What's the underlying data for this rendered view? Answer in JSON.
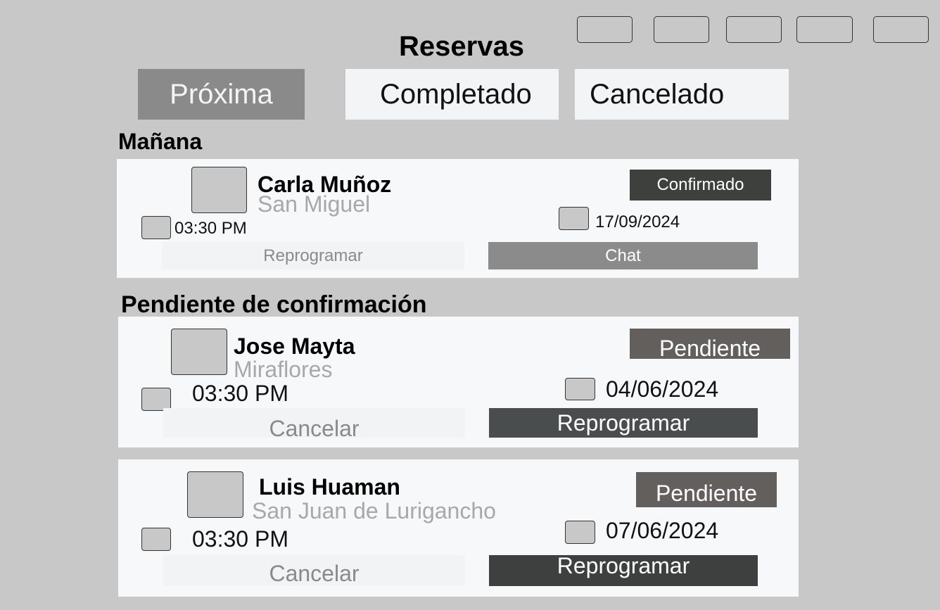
{
  "header": {
    "title": "Reservas"
  },
  "tabs": [
    {
      "label": "Próxima"
    },
    {
      "label": "Completado"
    },
    {
      "label": "Cancelado"
    }
  ],
  "sections": [
    {
      "heading": "Mañana",
      "cards": [
        {
          "name": "Carla Muñoz",
          "location": "San Miguel",
          "time": "03:30 PM",
          "date": "17/09/2024",
          "status": "Confirmado",
          "secondary_action": "Reprogramar",
          "primary_action": "Chat"
        }
      ]
    },
    {
      "heading": "Pendiente de confirmación",
      "cards": [
        {
          "name": "Jose Mayta",
          "location": "Miraflores",
          "time": "03:30 PM",
          "date": "04/06/2024",
          "status": "Pendiente",
          "secondary_action": "Cancelar",
          "primary_action": "Reprogramar"
        },
        {
          "name": "Luis Huaman",
          "location": "San Juan de Lurigancho",
          "time": "03:30 PM",
          "date": "07/06/2024",
          "status": "Pendiente",
          "secondary_action": "Cancelar",
          "primary_action": "Reprogramar"
        }
      ]
    }
  ],
  "colors": {
    "background": "#c8c8c8",
    "tab_active": "#8a8a8a",
    "status_confirmed": "#3d403d",
    "status_pending": "#625f5c",
    "primary_chat": "#8a8b8a",
    "primary_reschedule": "#4a4d4d"
  }
}
